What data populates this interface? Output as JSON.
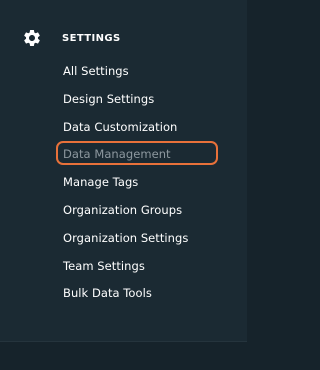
{
  "section": {
    "icon": "gear-icon",
    "title": "SETTINGS"
  },
  "menu": {
    "items": [
      {
        "label": "All Settings"
      },
      {
        "label": "Design Settings"
      },
      {
        "label": "Data Customization"
      },
      {
        "label": "Data Management"
      },
      {
        "label": "Manage Tags"
      },
      {
        "label": "Organization Groups"
      },
      {
        "label": "Organization Settings"
      },
      {
        "label": "Team Settings"
      },
      {
        "label": "Bulk Data Tools"
      }
    ],
    "selected_label": "Data Management"
  },
  "colors": {
    "background": "#1b2a33",
    "text": "#ffffff",
    "muted_text": "#8d989f",
    "highlight": "#e8713a"
  }
}
